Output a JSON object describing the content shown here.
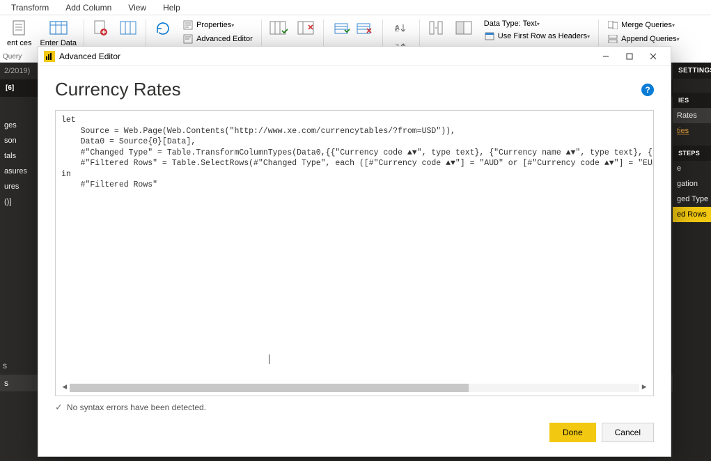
{
  "menubar": {
    "items": [
      "Transform",
      "Add Column",
      "View",
      "Help"
    ]
  },
  "ribbon": {
    "big_btn1": "ent\nces",
    "big_btn2": "Enter\nData",
    "properties": "Properties",
    "advanced_editor": "Advanced Editor",
    "data_type_label": "Data Type: Text",
    "first_row_label": "Use First Row as Headers",
    "merge_queries": "Merge Queries",
    "append_queries": "Append Queries",
    "query_label": "Query"
  },
  "queries": {
    "date_label": "2/2019)",
    "count": "[6]",
    "items": [
      "ges",
      "son",
      "tals",
      "asures",
      "ures",
      "()]"
    ]
  },
  "right": {
    "settings": "SETTINGS",
    "ies": "IES",
    "rates": "Rates",
    "ties": "ties",
    "steps": "STEPS",
    "s_items": [
      "e",
      "gation",
      "ged Type",
      "ed Rows"
    ]
  },
  "modal": {
    "window_title": "Advanced Editor",
    "heading": "Currency Rates",
    "code_l1": "let",
    "code_l2": "    Source = Web.Page(Web.Contents(\"http://www.xe.com/currencytables/?from=USD\")),",
    "code_l3": "    Data0 = Source{0}[Data],",
    "code_l4": "    #\"Changed Type\" = Table.TransformColumnTypes(Data0,{{\"Currency code ▲▼\", type text}, {\"Currency name ▲▼\", type text}, {\"Units per USD\", typ",
    "code_l5": "    #\"Filtered Rows\" = Table.SelectRows(#\"Changed Type\", each ([#\"Currency code ▲▼\"] = \"AUD\" or [#\"Currency code ▲▼\"] = \"EUR\" or [#\"Currency co",
    "code_l6": "in",
    "code_l7": "    #\"Filtered Rows\"",
    "status": "No syntax errors have been detected.",
    "done": "Done",
    "cancel": "Cancel"
  }
}
